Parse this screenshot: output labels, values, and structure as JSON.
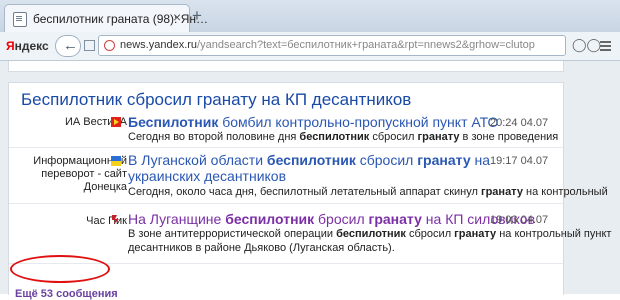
{
  "tab": {
    "title": "беспилотник граната (98): Ян…",
    "close": "×",
    "new": "+"
  },
  "browser": {
    "logo": "Яндекс",
    "url_host": "news.yandex.ru",
    "url_rest": "/yandsearch?text=беспилотник+граната&rpt=nnews2&grhow=clutop"
  },
  "story": {
    "headline": "Беспилотник сбросил гранату на КП десантников",
    "items": [
      {
        "source": "ИА ВестиУА",
        "title_parts": [
          "Беспилотник",
          " бомбил контрольно-пропускной пункт АТО"
        ],
        "time": "20:24 04.07",
        "snippet_parts": [
          "Сегодня во второй половине дня ",
          "беспилотник",
          " сбросил ",
          "гранату",
          " в зоне проведения"
        ],
        "icon_color": "#e2231a"
      },
      {
        "source_lines": [
          "Информационный",
          "переворот - сайт",
          "Донецка"
        ],
        "title_line1_parts": [
          "В Луганской области ",
          "беспилотник",
          " сбросил ",
          "гранату",
          " на"
        ],
        "title_line2": "украинских десантников",
        "time": "19:17 04.07",
        "snippet_parts": [
          "Сегодня, около часа дня, беспилотный летательный аппарат скинул ",
          "гранату",
          " на контрольный"
        ],
        "icon_color": "#2b6fd6"
      },
      {
        "source": "Час Пик",
        "title_parts": [
          "На Луганщине ",
          "беспилотник",
          " бросил ",
          "гранату",
          " на КП силовиков"
        ],
        "time": "19:03 04.07",
        "snippet_line1_parts": [
          "В зоне антитеррористической операции ",
          "беспилотник",
          " сбросил ",
          "гранату",
          " на контрольный пункт"
        ],
        "snippet_line2": "десантников в районе Дьяково (Луганская область).",
        "icon_color": "#c0212b"
      }
    ],
    "more": "Ещё 53 сообщения"
  }
}
